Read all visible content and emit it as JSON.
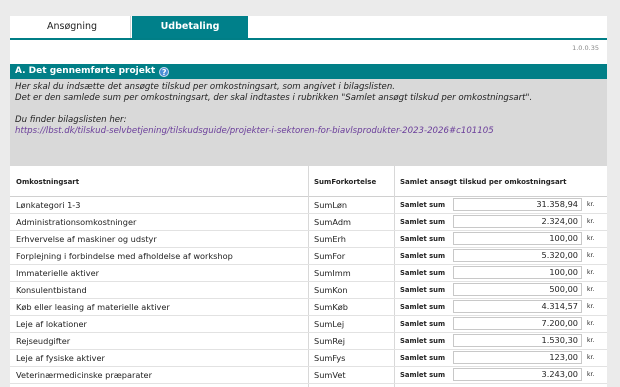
{
  "tabs": [
    {
      "label": "Ansøgning",
      "active": false
    },
    {
      "label": "Udbetaling",
      "active": true
    }
  ],
  "version": "1.0.0.35",
  "section": {
    "title": "A. Det gennemførte projekt",
    "line1": "Her skal du indsætte det ansøgte tilskud per omkostningsart, som angivet i bilagslisten.",
    "line2": "Det er den samlede sum per omkostningsart, der skal indtastes i rubrikken \"Samlet ansøgt tilskud per omkostningsart\".",
    "line3": "Du finder bilagslisten her:",
    "link": "https://lbst.dk/tilskud-selvbetjening/tilskudsguide/projekter-i-sektoren-for-biavlsprodukter-2023-2026#c101105"
  },
  "table": {
    "headers": [
      "Omkostningsart",
      "SumForkortelse",
      "Samlet ansøgt tilskud per omkostningsart"
    ],
    "rows": [
      {
        "name": "Lønkategori 1-3",
        "abbr": "SumLøn",
        "label": "Samlet sum",
        "value": "31.358,94",
        "unit": "kr."
      },
      {
        "name": "Administrationsomkostninger",
        "abbr": "SumAdm",
        "label": "Samlet sum",
        "value": "2.324,00",
        "unit": "kr."
      },
      {
        "name": "Erhvervelse af maskiner og udstyr",
        "abbr": "SumErh",
        "label": "Samlet sum",
        "value": "100,00",
        "unit": "kr."
      },
      {
        "name": "Forplejning i forbindelse med afholdelse af workshop",
        "abbr": "SumFor",
        "label": "Samlet sum",
        "value": "5.320,00",
        "unit": "kr."
      },
      {
        "name": "Immaterielle aktiver",
        "abbr": "SumImm",
        "label": "Samlet sum",
        "value": "100,00",
        "unit": "kr."
      },
      {
        "name": "Konsulentbistand",
        "abbr": "SumKon",
        "label": "Samlet sum",
        "value": "500,00",
        "unit": "kr."
      },
      {
        "name": "Køb eller leasing af materielle aktiver",
        "abbr": "SumKøb",
        "label": "Samlet sum",
        "value": "4.314,57",
        "unit": "kr."
      },
      {
        "name": "Leje af lokationer",
        "abbr": "SumLej",
        "label": "Samlet sum",
        "value": "7.200,00",
        "unit": "kr."
      },
      {
        "name": "Rejseudgifter",
        "abbr": "SumRej",
        "label": "Samlet sum",
        "value": "1.530,30",
        "unit": "kr."
      },
      {
        "name": "Leje af fysiske aktiver",
        "abbr": "SumFys",
        "label": "Samlet sum",
        "value": "123,00",
        "unit": "kr."
      },
      {
        "name": "Veterinærmedicinske præparater",
        "abbr": "SumVet",
        "label": "Samlet sum",
        "value": "3.243,00",
        "unit": "kr."
      }
    ]
  }
}
